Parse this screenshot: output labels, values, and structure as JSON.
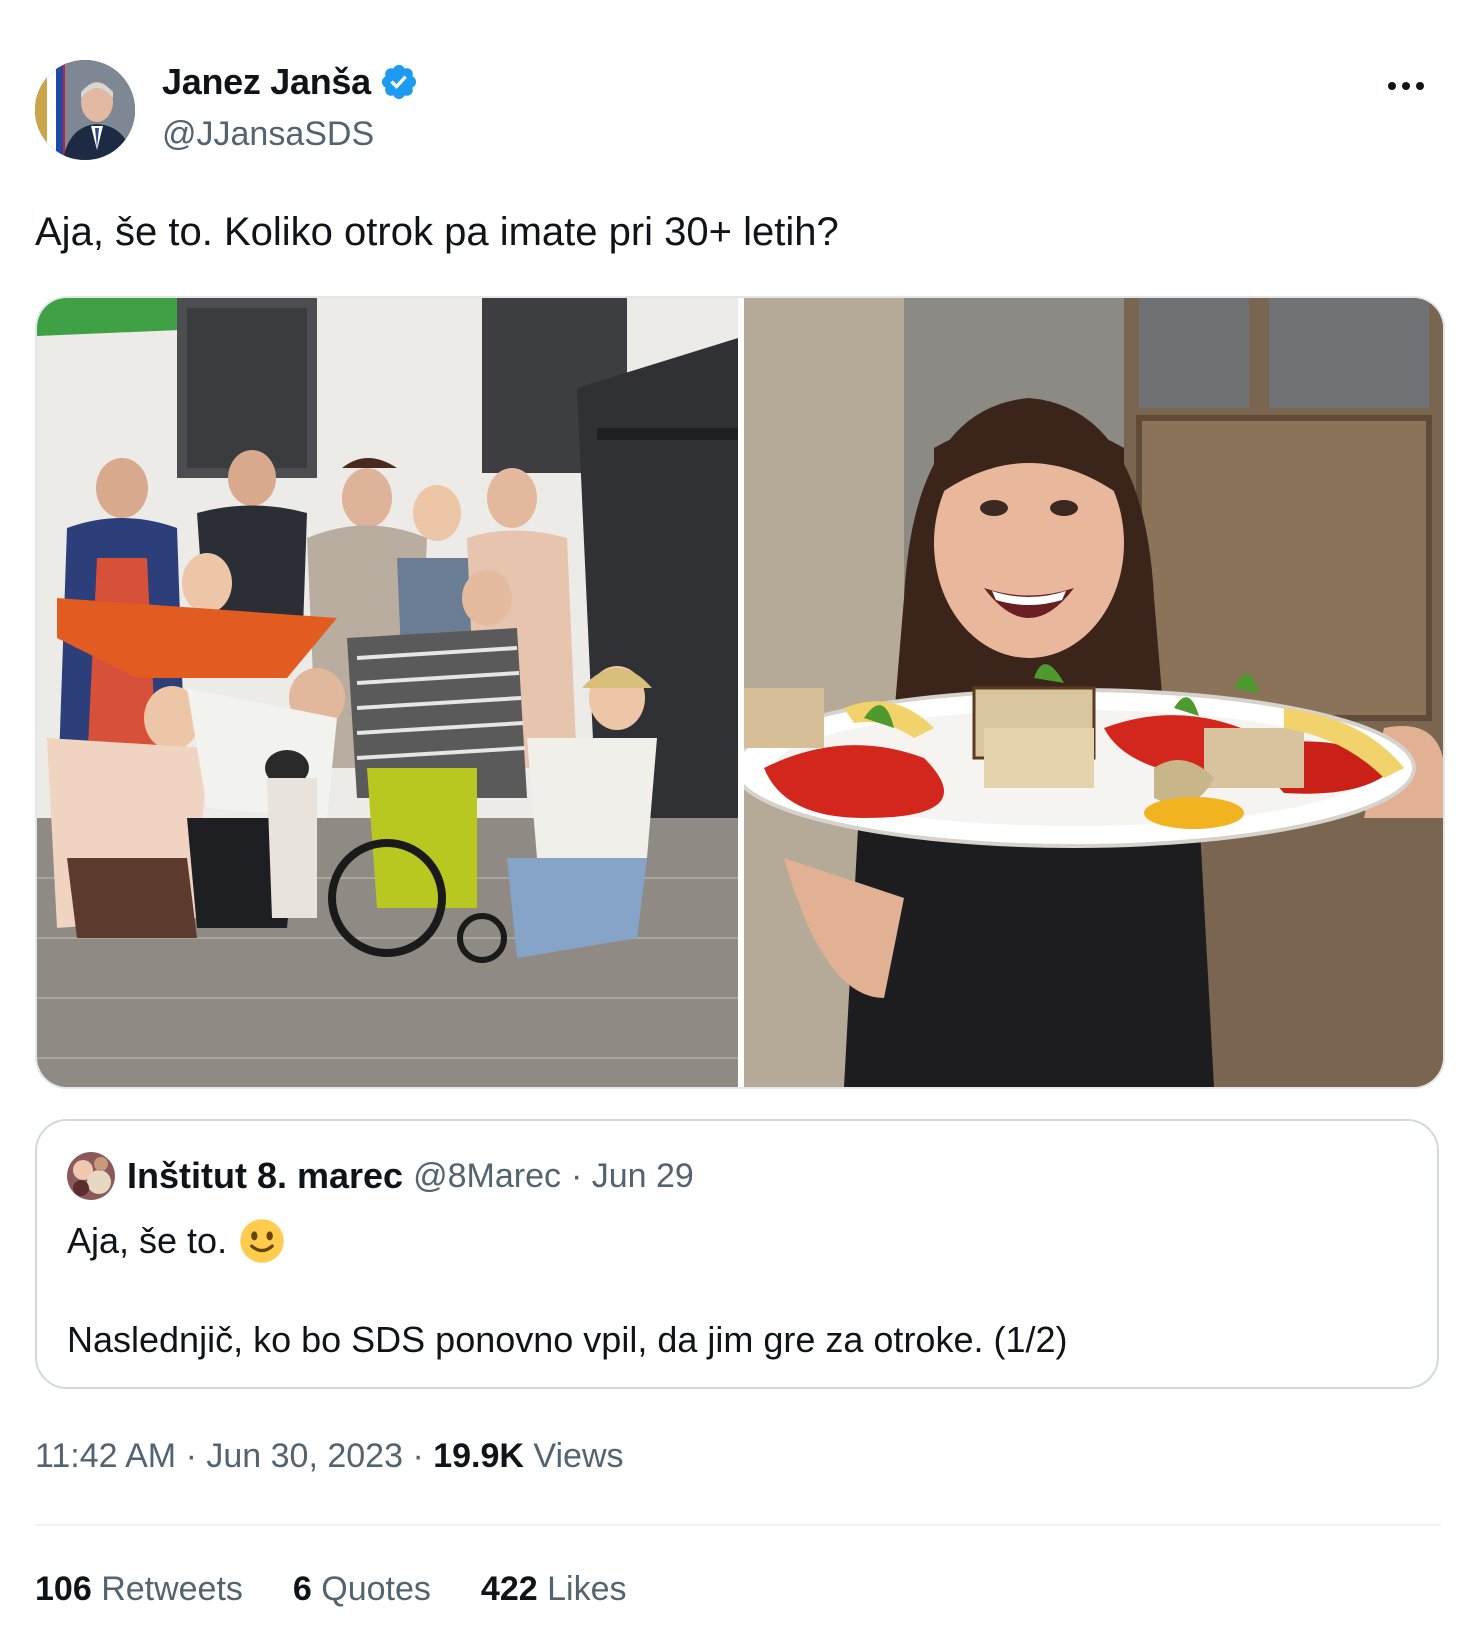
{
  "author": {
    "display_name": "Janez Janša",
    "handle": "@JJansaSDS",
    "verified": true,
    "verified_color": "#1d9bf0"
  },
  "tweet": {
    "text": "Aja, še to. Koliko otrok pa imate pri 30+ letih?"
  },
  "media": {
    "count": 2
  },
  "quoted": {
    "display_name": "Inštitut 8. marec",
    "handle": "@8Marec",
    "date": "· Jun 29",
    "line1": "Aja, še to.",
    "emoji": "slightly-smiling-face-icon",
    "line2": "Naslednjič, ko bo SDS ponovno vpil, da jim gre za otroke. (1/2)"
  },
  "meta": {
    "time": "11:42 AM",
    "separator": "·",
    "date": "Jun 30, 2023",
    "views_count": "19.9K",
    "views_label": "Views"
  },
  "stats": {
    "retweets_count": "106",
    "retweets_label": "Retweets",
    "quotes_count": "6",
    "quotes_label": "Quotes",
    "likes_count": "422",
    "likes_label": "Likes"
  },
  "icons": {
    "more": "more-horizontal-icon",
    "verified": "verified-badge-icon"
  }
}
